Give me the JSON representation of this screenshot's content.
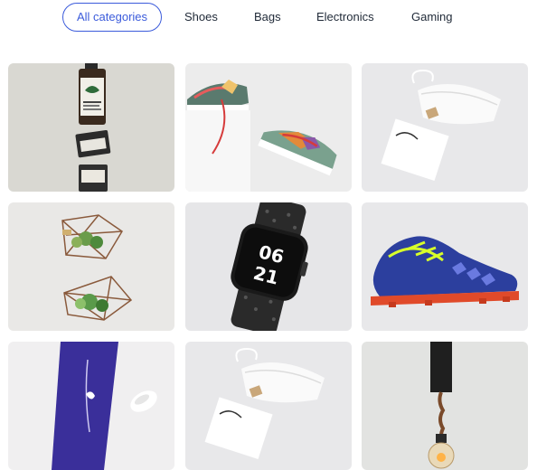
{
  "filters": {
    "items": [
      {
        "label": "All categories",
        "active": true
      },
      {
        "label": "Shoes",
        "active": false
      },
      {
        "label": "Bags",
        "active": false
      },
      {
        "label": "Electronics",
        "active": false
      },
      {
        "label": "Gaming",
        "active": false
      }
    ]
  },
  "gallery": {
    "tiles": [
      {
        "subject": "cosmetic bottles and jars stacked",
        "text_on_label": "LEMON MANDARIN"
      },
      {
        "subject": "pair of sneakers on a white block"
      },
      {
        "subject": "white drawstring pouch with card"
      },
      {
        "subject": "geometric planters with succulents"
      },
      {
        "subject": "smartwatch with sport band",
        "watch_face": [
          "06",
          "21"
        ]
      },
      {
        "subject": "blue football boot with yellow laces"
      },
      {
        "subject": "purple cream tube with swatch"
      },
      {
        "subject": "white drawstring pouch with card"
      },
      {
        "subject": "hanging bulb pendant lamp"
      }
    ]
  },
  "colors": {
    "accent": "#3b5bdb",
    "tile_bg": "#e6e6e8"
  }
}
